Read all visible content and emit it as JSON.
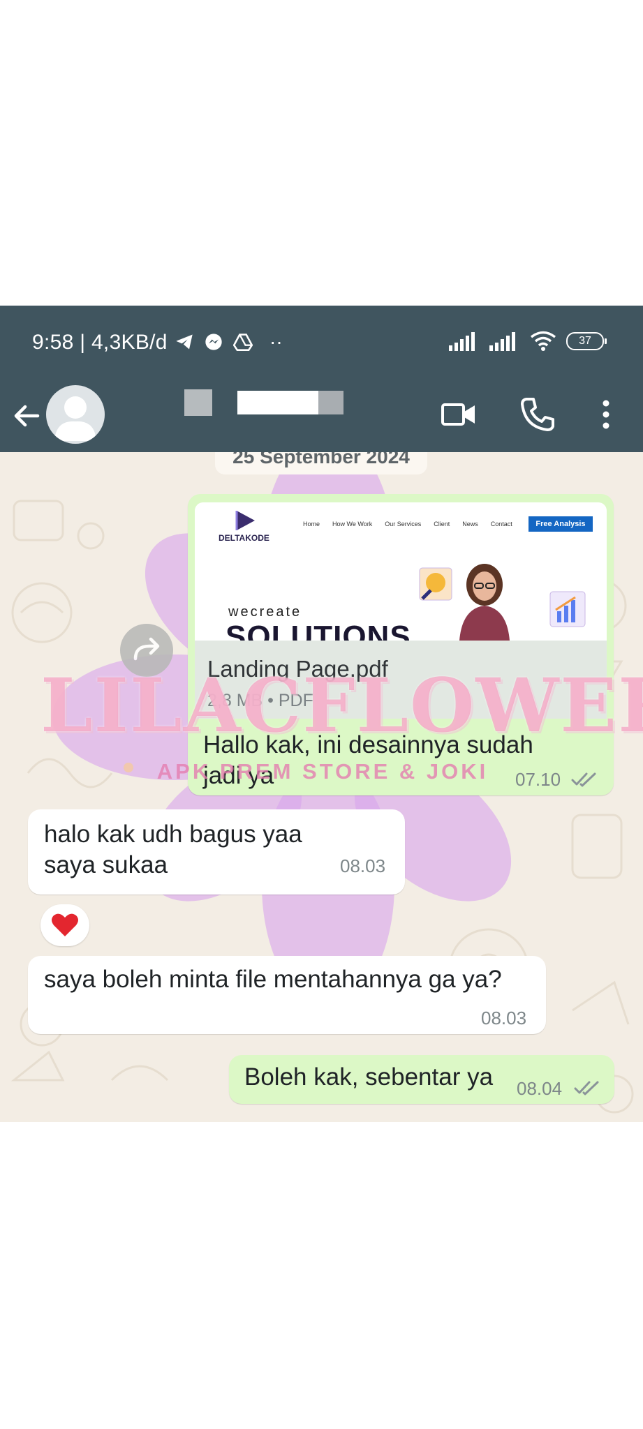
{
  "status_bar": {
    "time_speed": "9:58 | 4,3KB/d",
    "more_indicator": "··",
    "battery": "37"
  },
  "header": {
    "contact_name_redacted": true
  },
  "chat": {
    "date_chip": "25 September 2024",
    "messages": [
      {
        "kind": "document",
        "direction": "outgoing",
        "preview": {
          "brand": "DELTAKODE",
          "nav": [
            "Home",
            "How We Work",
            "Our Services",
            "Client",
            "News",
            "Contact"
          ],
          "cta": "Free Analysis",
          "headline_small": "wecreate",
          "headline_big": "SOLUTIONS"
        },
        "file_name": "Landing Page.pdf",
        "file_meta": "2,8 MB • PDF",
        "caption": "Hallo kak, ini desainnya sudah jadi ya",
        "time": "07.10",
        "status": "read"
      },
      {
        "kind": "text",
        "direction": "incoming",
        "text": "halo kak udh bagus yaa saya sukaa",
        "time": "08.03",
        "reaction": "❤️"
      },
      {
        "kind": "text",
        "direction": "incoming",
        "text": "saya boleh minta file mentahannya ga ya?",
        "time": "08.03"
      },
      {
        "kind": "text",
        "direction": "outgoing",
        "text": "Boleh kak, sebentar ya",
        "time": "08.04",
        "status": "read"
      }
    ]
  },
  "watermark": {
    "title": "LILACFLOWER",
    "subtitle": "APK PREM STORE & JOKI"
  },
  "colors": {
    "header": "#40555f",
    "chat_bg": "#f3ede4",
    "outgoing_bubble": "#dcf8c6",
    "incoming_bubble": "#ffffff",
    "watermark_flower": "#d9a7ec",
    "watermark_text": "#f39ebe"
  }
}
